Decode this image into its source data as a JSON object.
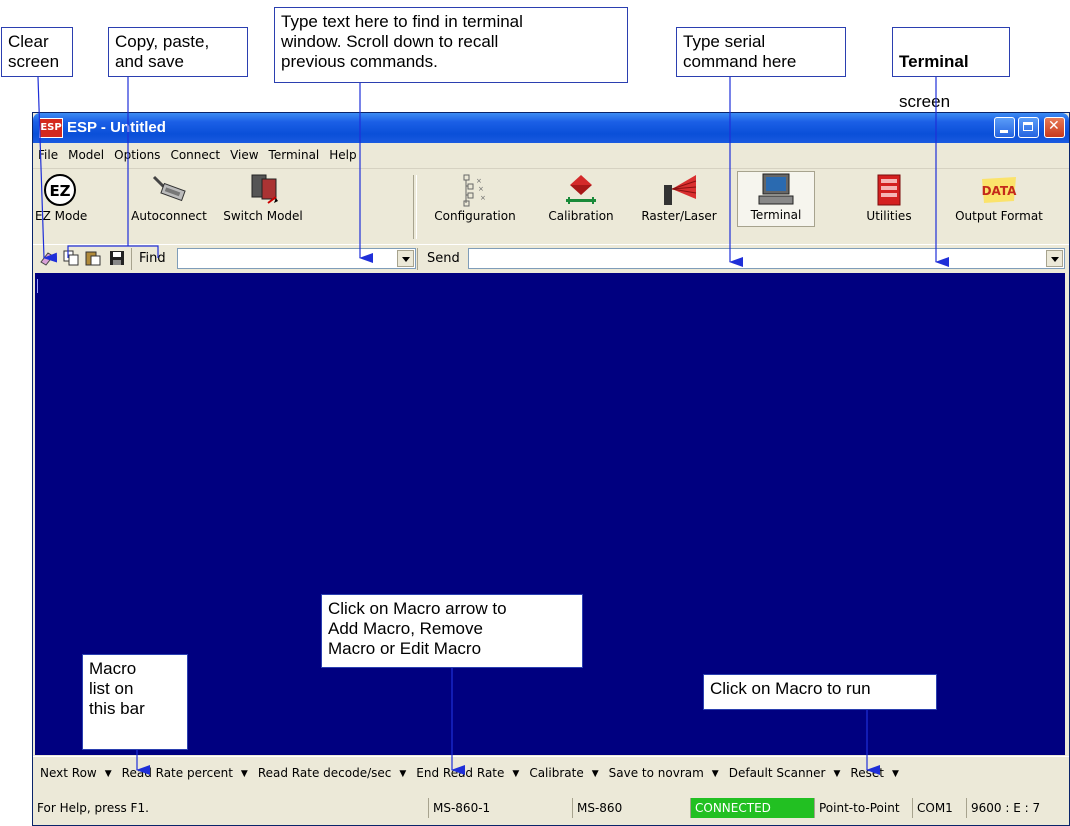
{
  "callouts": {
    "clear_screen": "Clear\nscreen",
    "copy_paste_save": "Copy, paste,\nand save",
    "find_text": "Type text here to find in terminal\nwindow. Scroll down to recall\nprevious commands.",
    "serial_command": "Type serial\ncommand here",
    "terminal_bold": "Terminal",
    "terminal_rest": "screen",
    "macro_arrow": "Click on Macro arrow to\nAdd Macro, Remove\nMacro or Edit Macro",
    "macro_list": "Macro\nlist on\nthis bar",
    "macro_run": "Click on Macro to run"
  },
  "window": {
    "title": "ESP - Untitled",
    "icon_text": "ESP"
  },
  "menu": [
    "File",
    "Model",
    "Options",
    "Connect",
    "View",
    "Terminal",
    "Help"
  ],
  "toolbar": {
    "ez_mode": "EZ Mode",
    "autoconnect": "Autoconnect",
    "switch_model": "Switch Model",
    "configuration": "Configuration",
    "calibration": "Calibration",
    "raster_laser": "Raster/Laser",
    "terminal": "Terminal",
    "utilities": "Utilities",
    "output_format": "Output Format",
    "ez_icon_text": "EZ",
    "data_icon_text": "DATA"
  },
  "findbar": {
    "find_label": "Find",
    "find_value": "",
    "send_label": "Send",
    "send_value": ""
  },
  "macros": [
    "Next Row",
    "Read Rate percent",
    "Read Rate decode/sec",
    "End Read Rate",
    "Calibrate",
    "Save to novram",
    "Default Scanner",
    "Reset"
  ],
  "status": {
    "help": "For Help, press F1.",
    "model1": "MS-860-1",
    "model2": "MS-860",
    "connection": "CONNECTED",
    "mode": "Point-to-Point",
    "port": "COM1",
    "settings": "9600 : E : 7"
  },
  "colors": {
    "terminal_bg": "#000080",
    "connected_bg": "#22c022",
    "callout_border": "#2b3fb0",
    "arrow": "#1f2fd8"
  }
}
